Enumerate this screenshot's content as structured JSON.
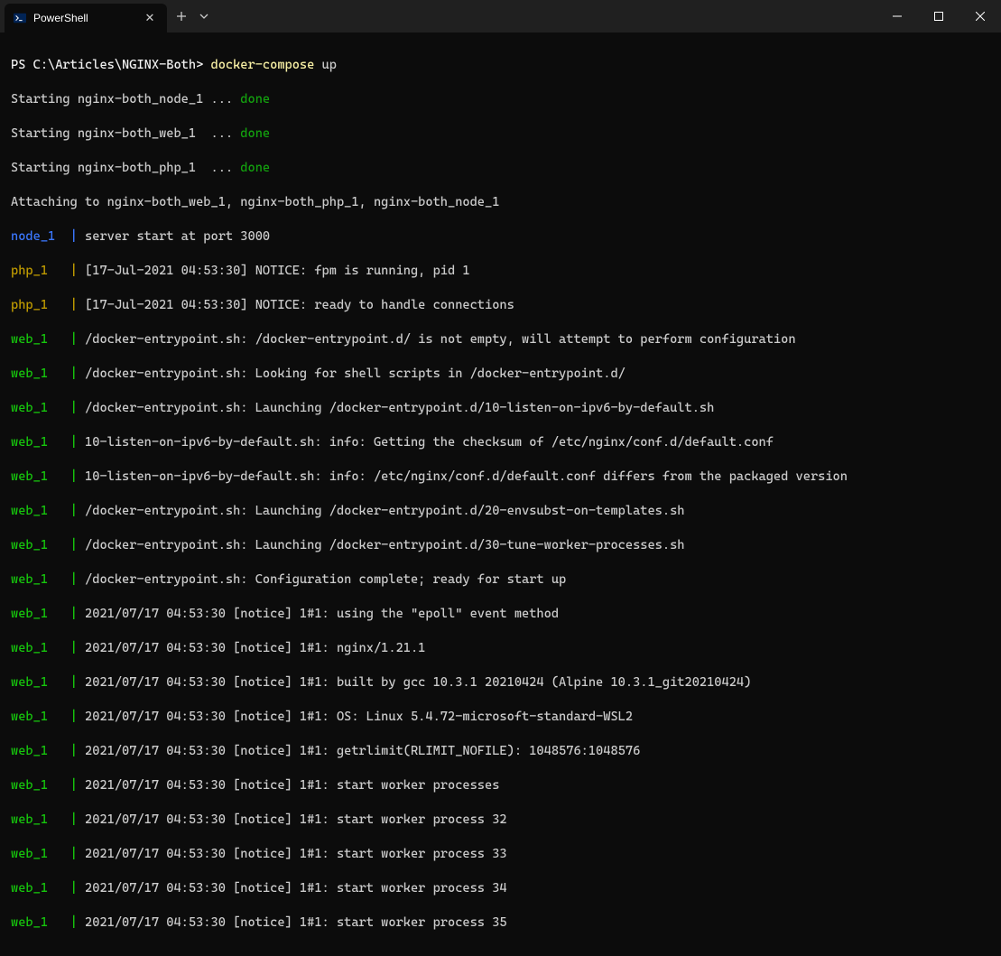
{
  "tab": {
    "title": "PowerShell"
  },
  "prompt": {
    "path": "PS C:\\Articles\\NGINX-Both>",
    "cmd": " docker-compose",
    "args": " up"
  },
  "lines": {
    "start1_a": "Starting nginx-both_node_1 ... ",
    "start1_b": "done",
    "start2_a": "Starting nginx-both_web_1  ... ",
    "start2_b": "done",
    "start3_a": "Starting nginx-both_php_1  ... ",
    "start3_b": "done",
    "attach": "Attaching to nginx-both_web_1, nginx-both_php_1, nginx-both_node_1",
    "l1_prefix": "node_1  ",
    "l1_sep": "| ",
    "l1_text": "server start at port 3000",
    "l2_prefix": "php_1   ",
    "l2_text": "[17-Jul-2021 04:53:30] NOTICE: fpm is running, pid 1",
    "l3_prefix": "php_1   ",
    "l3_text": "[17-Jul-2021 04:53:30] NOTICE: ready to handle connections",
    "l4_prefix": "web_1   ",
    "l4_text": "/docker-entrypoint.sh: /docker-entrypoint.d/ is not empty, will attempt to perform configuration",
    "l5_prefix": "web_1   ",
    "l5_text": "/docker-entrypoint.sh: Looking for shell scripts in /docker-entrypoint.d/",
    "l6_prefix": "web_1   ",
    "l6_text": "/docker-entrypoint.sh: Launching /docker-entrypoint.d/10-listen-on-ipv6-by-default.sh",
    "l7_prefix": "web_1   ",
    "l7_text": "10-listen-on-ipv6-by-default.sh: info: Getting the checksum of /etc/nginx/conf.d/default.conf",
    "l8_prefix": "web_1   ",
    "l8_text": "10-listen-on-ipv6-by-default.sh: info: /etc/nginx/conf.d/default.conf differs from the packaged version",
    "l9_prefix": "web_1   ",
    "l9_text": "/docker-entrypoint.sh: Launching /docker-entrypoint.d/20-envsubst-on-templates.sh",
    "l10_prefix": "web_1   ",
    "l10_text": "/docker-entrypoint.sh: Launching /docker-entrypoint.d/30-tune-worker-processes.sh",
    "l11_prefix": "web_1   ",
    "l11_text": "/docker-entrypoint.sh: Configuration complete; ready for start up",
    "l12_prefix": "web_1   ",
    "l12_text": "2021/07/17 04:53:30 [notice] 1#1: using the \"epoll\" event method",
    "l13_prefix": "web_1   ",
    "l13_text": "2021/07/17 04:53:30 [notice] 1#1: nginx/1.21.1",
    "l14_prefix": "web_1   ",
    "l14_text": "2021/07/17 04:53:30 [notice] 1#1: built by gcc 10.3.1 20210424 (Alpine 10.3.1_git20210424)",
    "l15_prefix": "web_1   ",
    "l15_text": "2021/07/17 04:53:30 [notice] 1#1: OS: Linux 5.4.72-microsoft-standard-WSL2",
    "l16_prefix": "web_1   ",
    "l16_text": "2021/07/17 04:53:30 [notice] 1#1: getrlimit(RLIMIT_NOFILE): 1048576:1048576",
    "l17_prefix": "web_1   ",
    "l17_text": "2021/07/17 04:53:30 [notice] 1#1: start worker processes",
    "l18_prefix": "web_1   ",
    "l18_text": "2021/07/17 04:53:30 [notice] 1#1: start worker process 32",
    "l19_prefix": "web_1   ",
    "l19_text": "2021/07/17 04:53:30 [notice] 1#1: start worker process 33",
    "l20_prefix": "web_1   ",
    "l20_text": "2021/07/17 04:53:30 [notice] 1#1: start worker process 34",
    "l21_prefix": "web_1   ",
    "l21_text": "2021/07/17 04:53:30 [notice] 1#1: start worker process 35"
  }
}
